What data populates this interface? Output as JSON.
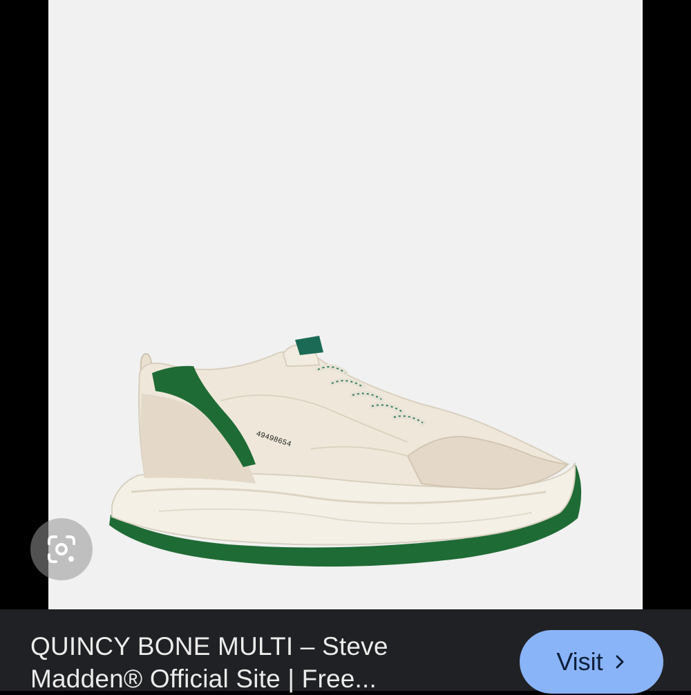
{
  "image": {
    "description_icon": "sneaker-photo",
    "shoe_code": "49498654",
    "background_color": "#f1f1f1"
  },
  "lens": {
    "icon": "google-lens-icon"
  },
  "result": {
    "title_line1": "QUINCY BONE MULTI – Steve",
    "title_line2": "Madden® Official Site | Free..."
  },
  "visit": {
    "label": "Visit",
    "icon": "chevron-right-icon",
    "color": "#8ab4f8"
  }
}
